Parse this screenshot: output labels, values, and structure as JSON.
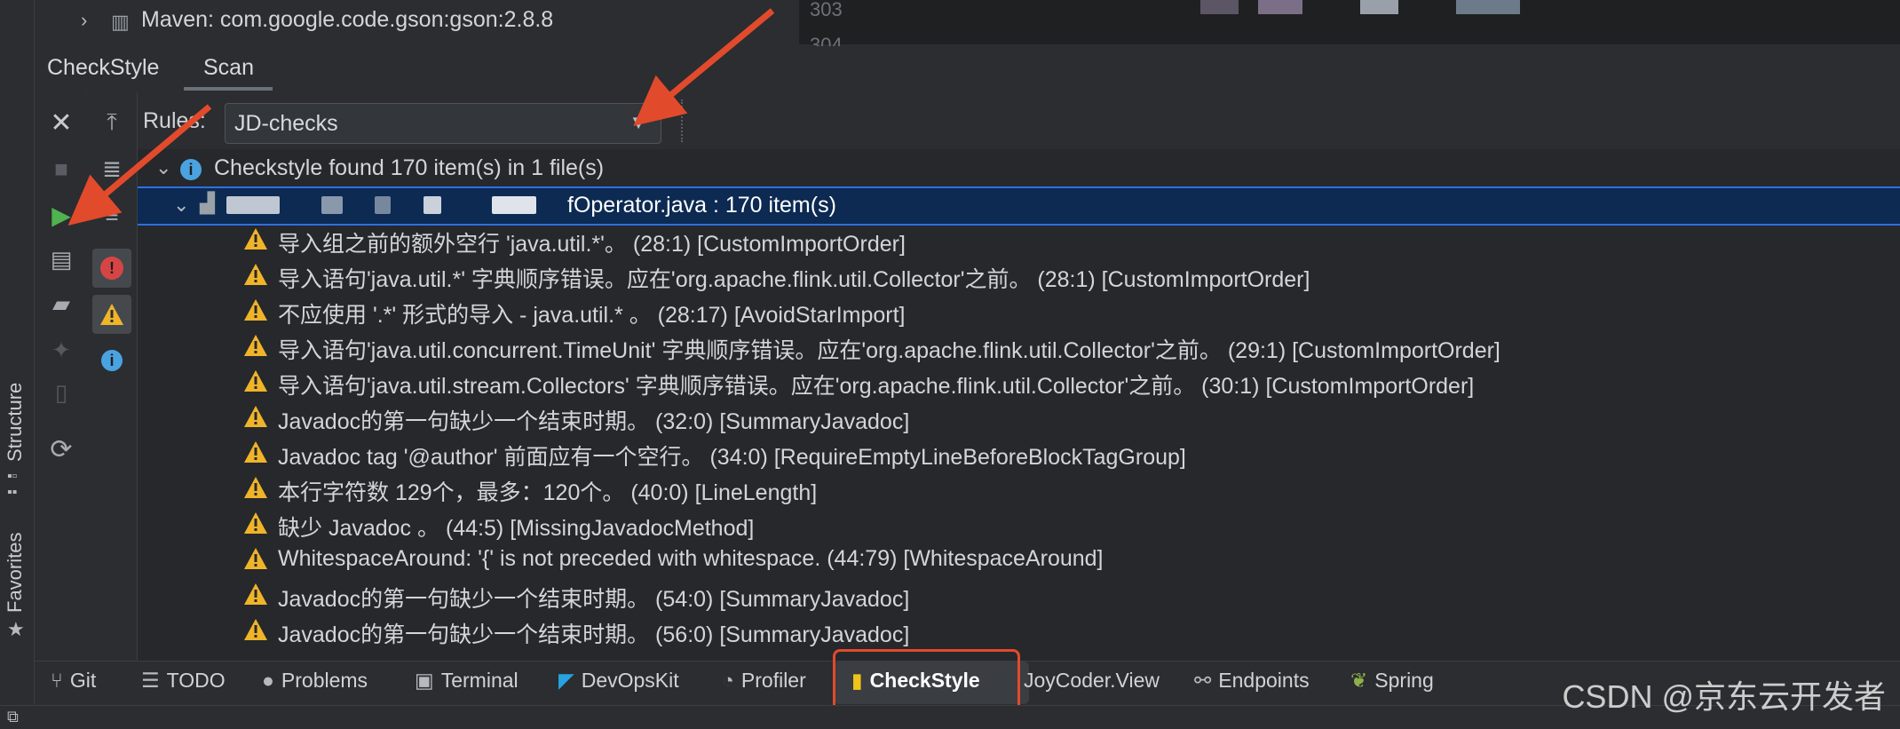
{
  "project_tree": {
    "maven_item": "Maven: com.google.code.gson:gson:2.8.8",
    "line_303": "303",
    "line_304": "304"
  },
  "tabs": [
    {
      "label": "CheckStyle"
    },
    {
      "label": "Scan"
    }
  ],
  "rules": {
    "label": "Rules:",
    "value": "JD-checks"
  },
  "side_labels": {
    "structure": "Structure",
    "favorites": "Favorites"
  },
  "summary": "Checkstyle found 170 item(s) in 1 file(s)",
  "file_row": "fOperator.java : 170 item(s)",
  "issues": [
    "导入组之前的额外空行 'java.util.*'。 (28:1) [CustomImportOrder]",
    "导入语句'java.util.*' 字典顺序错误。应在'org.apache.flink.util.Collector'之前。 (28:1) [CustomImportOrder]",
    "不应使用 '.*' 形式的导入 - java.util.* 。 (28:17) [AvoidStarImport]",
    "导入语句'java.util.concurrent.TimeUnit' 字典顺序错误。应在'org.apache.flink.util.Collector'之前。 (29:1) [CustomImportOrder]",
    "导入语句'java.util.stream.Collectors' 字典顺序错误。应在'org.apache.flink.util.Collector'之前。 (30:1) [CustomImportOrder]",
    "Javadoc的第一句缺少一个结束时期。 (32:0) [SummaryJavadoc]",
    "Javadoc tag '@author' 前面应有一个空行。 (34:0) [RequireEmptyLineBeforeBlockTagGroup]",
    "本行字符数 129个，最多：120个。 (40:0) [LineLength]",
    "缺少 Javadoc 。 (44:5) [MissingJavadocMethod]",
    "WhitespaceAround: '{' is not preceded with whitespace. (44:79) [WhitespaceAround]",
    "Javadoc的第一句缺少一个结束时期。 (54:0) [SummaryJavadoc]",
    "Javadoc的第一句缺少一个结束时期。 (56:0) [SummaryJavadoc]"
  ],
  "bottom_tabs": {
    "git": "Git",
    "todo": "TODO",
    "problems": "Problems",
    "terminal": "Terminal",
    "devopskit": "DevOpsKit",
    "profiler": "Profiler",
    "checkstyle": "CheckStyle",
    "joycoder": "JoyCoder.View",
    "endpoints": "Endpoints",
    "spring": "Spring"
  },
  "watermark": "CSDN @京东云开发者",
  "colors": {
    "warning": "#f0b429",
    "info": "#4aa3e0",
    "run_green": "#4fb34f",
    "annotation_red": "#e24a2c",
    "selection": "#0c2a52"
  }
}
